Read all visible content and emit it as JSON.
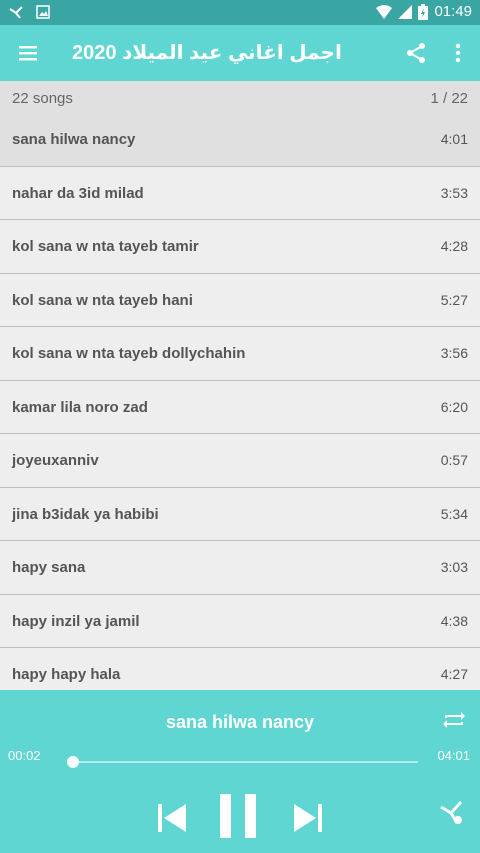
{
  "status_bar": {
    "time": "01:49",
    "icons": [
      "bluetooth-share-icon",
      "image-icon",
      "wifi-icon",
      "signal-icon",
      "battery-charging-icon"
    ]
  },
  "app_bar": {
    "title": "2020 اجمل اغاني عيد الميلاد",
    "icons": [
      "menu-icon",
      "share-icon",
      "more-vert-icon"
    ]
  },
  "list_header": {
    "count_label": "22 songs",
    "page_label": "1 / 22"
  },
  "songs": [
    {
      "name": "sana hilwa nancy",
      "duration": "4:01",
      "selected": true
    },
    {
      "name": "nahar da 3id milad",
      "duration": "3:53"
    },
    {
      "name": "kol sana w nta tayeb tamir",
      "duration": "4:28"
    },
    {
      "name": "kol sana w nta tayeb hani",
      "duration": "5:27"
    },
    {
      "name": "kol sana w nta tayeb dollychahin",
      "duration": "3:56"
    },
    {
      "name": "kamar lila noro zad",
      "duration": "6:20"
    },
    {
      "name": "joyeuxanniv",
      "duration": "0:57"
    },
    {
      "name": "jina b3idak ya habibi",
      "duration": "5:34"
    },
    {
      "name": "hapy sana",
      "duration": "3:03"
    },
    {
      "name": "hapy inzil ya jamil",
      "duration": "4:38"
    },
    {
      "name": "hapy hapy hala",
      "duration": "4:27"
    }
  ],
  "player": {
    "now_playing": "sana hilwa nancy",
    "elapsed": "00:02",
    "total": "04:01",
    "progress_fraction": 0.008,
    "icons": [
      "repeat-icon",
      "skip-previous-icon",
      "pause-icon",
      "skip-next-icon",
      "bluetooth-share-icon"
    ]
  },
  "colors": {
    "status_bar": "#3aa6a3",
    "accent": "#5fd6d2",
    "list_background": "#eeeeee",
    "selected_row": "#e0e0e0"
  }
}
